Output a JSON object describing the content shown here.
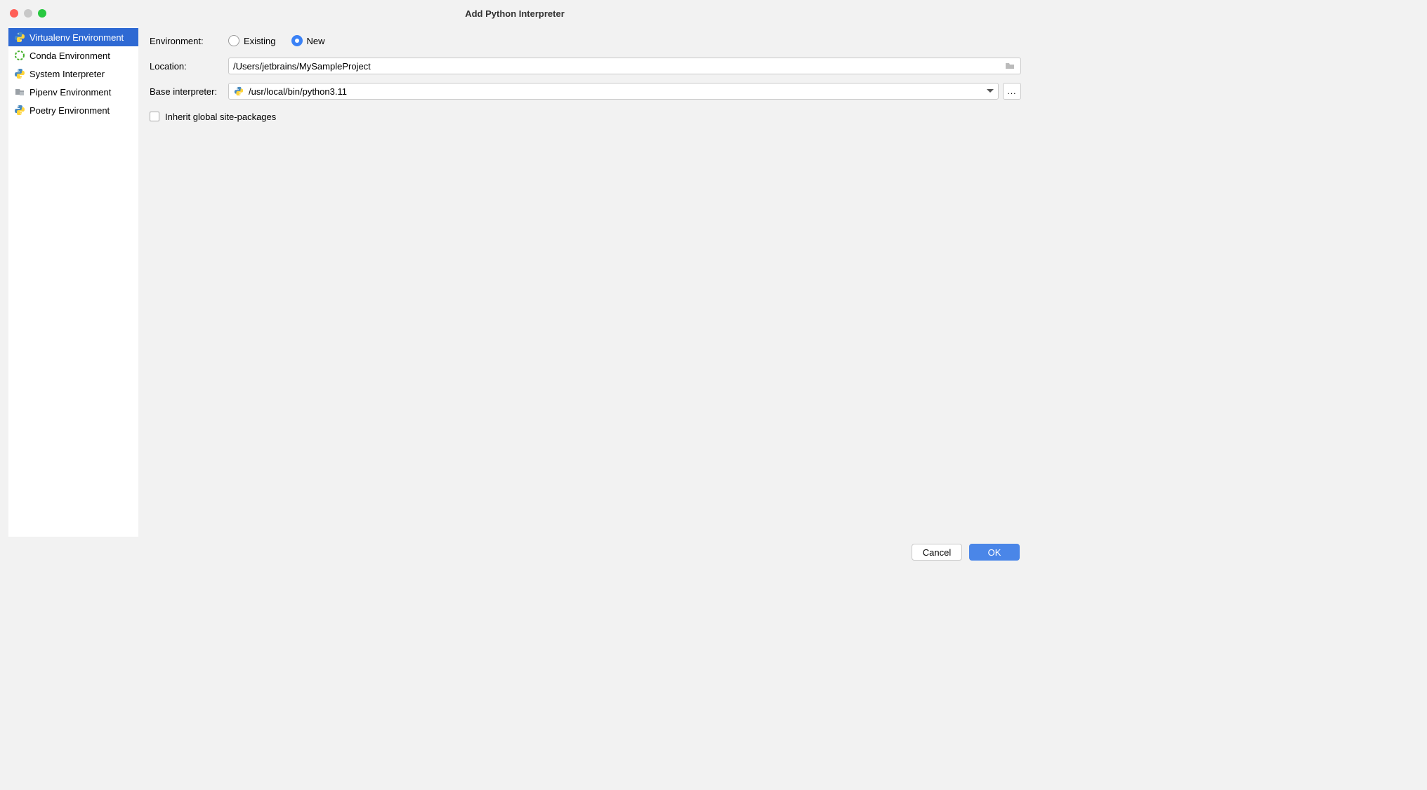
{
  "window": {
    "title": "Add Python Interpreter"
  },
  "sidebar": {
    "items": [
      {
        "label": "Virtualenv Environment",
        "selected": true
      },
      {
        "label": "Conda Environment",
        "selected": false
      },
      {
        "label": "System Interpreter",
        "selected": false
      },
      {
        "label": "Pipenv Environment",
        "selected": false
      },
      {
        "label": "Poetry Environment",
        "selected": false
      }
    ]
  },
  "form": {
    "environment_label": "Environment:",
    "radios": {
      "existing": "Existing",
      "new": "New",
      "selected": "new"
    },
    "location_label": "Location:",
    "location_value": "/Users/jetbrains/MySampleProject",
    "base_label": "Base interpreter:",
    "base_value": "/usr/local/bin/python3.11",
    "ellipsis": "...",
    "checkbox_label": "Inherit global site-packages",
    "checkbox_checked": false
  },
  "footer": {
    "cancel": "Cancel",
    "ok": "OK"
  }
}
